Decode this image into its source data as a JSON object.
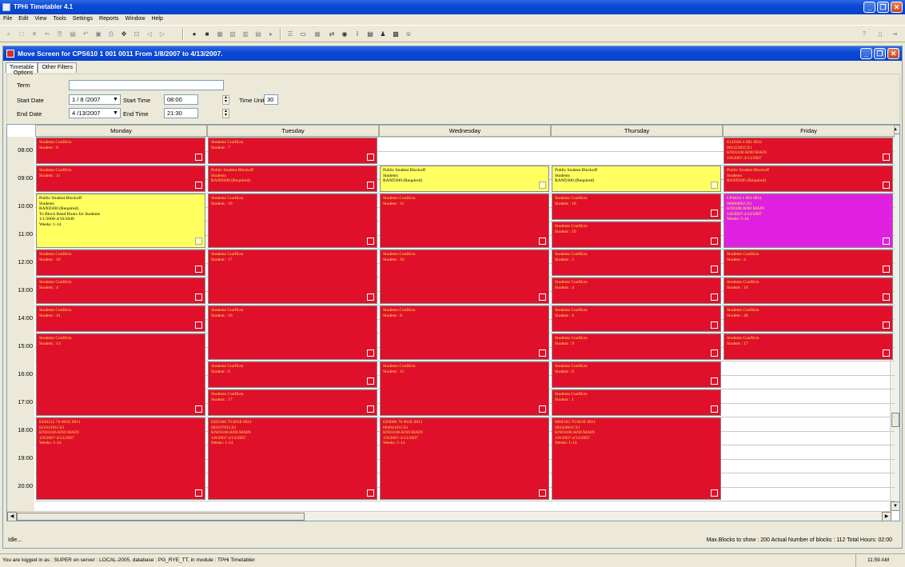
{
  "app": {
    "title": "TPHi Timetabler 4.1"
  },
  "menu": [
    "File",
    "Edit",
    "View",
    "Tools",
    "Settings",
    "Reports",
    "Window",
    "Help"
  ],
  "child_window": {
    "title": "Move Screen for CPS610  1  001  0011  From 1/8/2007 to 4/13/2007."
  },
  "tabs": [
    "Timetable",
    "Other Filters"
  ],
  "options": {
    "legend": "Options",
    "term_label": "Term",
    "term_value": "",
    "start_date_label": "Start Date",
    "start_date": "1 / 8 /2007",
    "end_date_label": "End Date",
    "end_date": "4 /13/2007",
    "start_time_label": "Start Time",
    "start_time": "08:00",
    "end_time_label": "End Time",
    "end_time": "21:30",
    "time_unit_label": "Time Unit",
    "time_unit": "30"
  },
  "days": [
    "Monday",
    "Tuesday",
    "Wednesday",
    "Thursday",
    "Friday"
  ],
  "times": [
    "08:00",
    "09:00",
    "10:00",
    "11:00",
    "12:00",
    "13:00",
    "14:00",
    "15:00",
    "16:00",
    "17:00",
    "18:00",
    "19:00",
    "20:00",
    "21:00"
  ],
  "blocks": [
    {
      "day": 0,
      "start": 0,
      "end": 2,
      "color": "red",
      "lines": [
        "Students Conflicts",
        "Student : 6"
      ]
    },
    {
      "day": 0,
      "start": 2,
      "end": 4,
      "color": "red",
      "lines": [
        "Students Conflicts",
        "Student : 11"
      ]
    },
    {
      "day": 0,
      "start": 4,
      "end": 8,
      "color": "yellow",
      "lines": [
        "Public Student Blockoff",
        "Students",
        "RAND300 (Required)",
        "To Block Band Hours for Students",
        "1/1/2006-4/16/2040",
        "Weeks: 1-14"
      ]
    },
    {
      "day": 0,
      "start": 8,
      "end": 10,
      "color": "red",
      "lines": [
        "Students Conflicts",
        "Student : 19"
      ]
    },
    {
      "day": 0,
      "start": 10,
      "end": 12,
      "color": "red",
      "lines": [
        "Students Conflicts",
        "Student : 4"
      ]
    },
    {
      "day": 0,
      "start": 12,
      "end": 14,
      "color": "red",
      "lines": [
        "Students Conflicts",
        "Student : 41"
      ]
    },
    {
      "day": 0,
      "start": 14,
      "end": 20,
      "color": "red",
      "lines": [
        "Students Conflicts",
        "Student : 13"
      ]
    },
    {
      "day": 0,
      "start": 20,
      "end": 26,
      "color": "red",
      "lines": [
        "EEI0212 70 001E 0011",
        "02161201CS1",
        "KN03106 KN0 MAIN",
        "1/8/2007-4/13/2007",
        "Weeks: 1-14"
      ]
    },
    {
      "day": 1,
      "start": 0,
      "end": 2,
      "color": "red",
      "lines": [
        "Students Conflicts",
        "Student : 7"
      ]
    },
    {
      "day": 1,
      "start": 2,
      "end": 4,
      "color": "red",
      "lines": [
        "Public Student Blockoff",
        "Students",
        "RAND300 (Required)"
      ]
    },
    {
      "day": 1,
      "start": 4,
      "end": 8,
      "color": "red",
      "lines": [
        "Students Conflicts",
        "Student : 19"
      ]
    },
    {
      "day": 1,
      "start": 8,
      "end": 12,
      "color": "red",
      "lines": [
        "Students Conflicts",
        "Student : 17"
      ]
    },
    {
      "day": 1,
      "start": 12,
      "end": 16,
      "color": "red",
      "lines": [
        "Students Conflicts",
        "Student : 10"
      ]
    },
    {
      "day": 1,
      "start": 16,
      "end": 18,
      "color": "red",
      "lines": [
        "Students Conflicts",
        "Student : 6"
      ]
    },
    {
      "day": 1,
      "start": 18,
      "end": 20,
      "color": "red",
      "lines": [
        "Students Conflicts",
        "Student : 17"
      ]
    },
    {
      "day": 1,
      "start": 20,
      "end": 26,
      "color": "red",
      "lines": [
        "EED100 70 001E 0011",
        "00319701CS1",
        "KN03106 KN0 MAIN",
        "1/8/2007-4/13/2007",
        "Weeks: 1-14"
      ]
    },
    {
      "day": 2,
      "start": 2,
      "end": 4,
      "color": "yellow",
      "lines": [
        "Public Student Blockoff",
        "Students",
        "RAND300 (Required)"
      ]
    },
    {
      "day": 2,
      "start": 4,
      "end": 8,
      "color": "red",
      "lines": [
        "Students Conflicts",
        "Student : 11"
      ]
    },
    {
      "day": 2,
      "start": 8,
      "end": 12,
      "color": "red",
      "lines": [
        "Students Conflicts",
        "Student : 10"
      ]
    },
    {
      "day": 2,
      "start": 12,
      "end": 16,
      "color": "red",
      "lines": [
        "Students Conflicts",
        "Student : 8"
      ]
    },
    {
      "day": 2,
      "start": 16,
      "end": 20,
      "color": "red",
      "lines": [
        "Students Conflicts",
        "Student : 15"
      ]
    },
    {
      "day": 2,
      "start": 20,
      "end": 26,
      "color": "red",
      "lines": [
        "EDI000 70 001E 0011",
        "00494101CS1",
        "KN03106 KN0 MAIN",
        "1/8/2007-4/13/2007",
        "Weeks: 1-14"
      ]
    },
    {
      "day": 3,
      "start": 2,
      "end": 4,
      "color": "yellow",
      "lines": [
        "Public Student Blockoff",
        "Students",
        "RAND300 (Required)"
      ]
    },
    {
      "day": 3,
      "start": 4,
      "end": 6,
      "color": "red",
      "lines": [
        "Students Conflicts",
        "Student : 10"
      ]
    },
    {
      "day": 3,
      "start": 6,
      "end": 8,
      "color": "red",
      "lines": [
        "Students Conflicts",
        "Student : 10"
      ]
    },
    {
      "day": 3,
      "start": 8,
      "end": 10,
      "color": "red",
      "lines": [
        "Students Conflicts",
        "Student : 3"
      ]
    },
    {
      "day": 3,
      "start": 10,
      "end": 12,
      "color": "red",
      "lines": [
        "Students Conflicts",
        "Student : 4"
      ]
    },
    {
      "day": 3,
      "start": 12,
      "end": 14,
      "color": "red",
      "lines": [
        "Students Conflicts",
        "Student : 4"
      ]
    },
    {
      "day": 3,
      "start": 14,
      "end": 16,
      "color": "red",
      "lines": [
        "Students Conflicts",
        "Student : 9"
      ]
    },
    {
      "day": 3,
      "start": 16,
      "end": 18,
      "color": "red",
      "lines": [
        "Students Conflicts",
        "Student : 8"
      ]
    },
    {
      "day": 3,
      "start": 18,
      "end": 20,
      "color": "red",
      "lines": [
        "Students Conflicts",
        "Student : 1"
      ]
    },
    {
      "day": 3,
      "start": 20,
      "end": 26,
      "color": "red",
      "lines": [
        "MHI103 70 001E 0011",
        "00343601CS1",
        "KN03106 KN0 MAIN",
        "1/8/2007-4/13/2007",
        "Weeks: 1-14"
      ]
    },
    {
      "day": 4,
      "start": 0,
      "end": 2,
      "color": "red",
      "lines": [
        "ELE046 4 001 0011",
        "00122301CS1",
        "KN03106 KN0 MAIN",
        "1/8/2007-4/13/2007"
      ]
    },
    {
      "day": 4,
      "start": 2,
      "end": 4,
      "color": "red",
      "lines": [
        "Public Student Blockoff",
        "Students",
        "RAND300 (Required)"
      ]
    },
    {
      "day": 4,
      "start": 4,
      "end": 8,
      "color": "magenta",
      "lines": [
        "CPS610 1 001 0011",
        "00066601CS1",
        "KN0106 KN0 MAIN",
        "1/8/2007-4/13/2007",
        "Weeks: 1-14"
      ]
    },
    {
      "day": 4,
      "start": 8,
      "end": 10,
      "color": "red",
      "lines": [
        "Students Conflicts",
        "Student : 4"
      ]
    },
    {
      "day": 4,
      "start": 10,
      "end": 12,
      "color": "red",
      "lines": [
        "Students Conflicts",
        "Student : 10"
      ]
    },
    {
      "day": 4,
      "start": 12,
      "end": 14,
      "color": "red",
      "lines": [
        "Students Conflicts",
        "Student : 40"
      ]
    },
    {
      "day": 4,
      "start": 14,
      "end": 16,
      "color": "red",
      "lines": [
        "Students Conflicts",
        "Student : 17"
      ]
    }
  ],
  "status": {
    "left": "Idle...",
    "right": "Max.Blocks to show : 200  Actual Number of blocks : 112  Total Hours: 02:00"
  },
  "taskbar": {
    "text": "You are logged in as : SUPER on server : LOCAL-2005, database : PG_RYE_TT, in module : TPHi Timetabler",
    "clock": "11:59 AM"
  },
  "colors": {
    "red": "#e0102a",
    "yellow": "#ffff60",
    "magenta": "#e020e0",
    "titlebar": "#0a49d8"
  }
}
